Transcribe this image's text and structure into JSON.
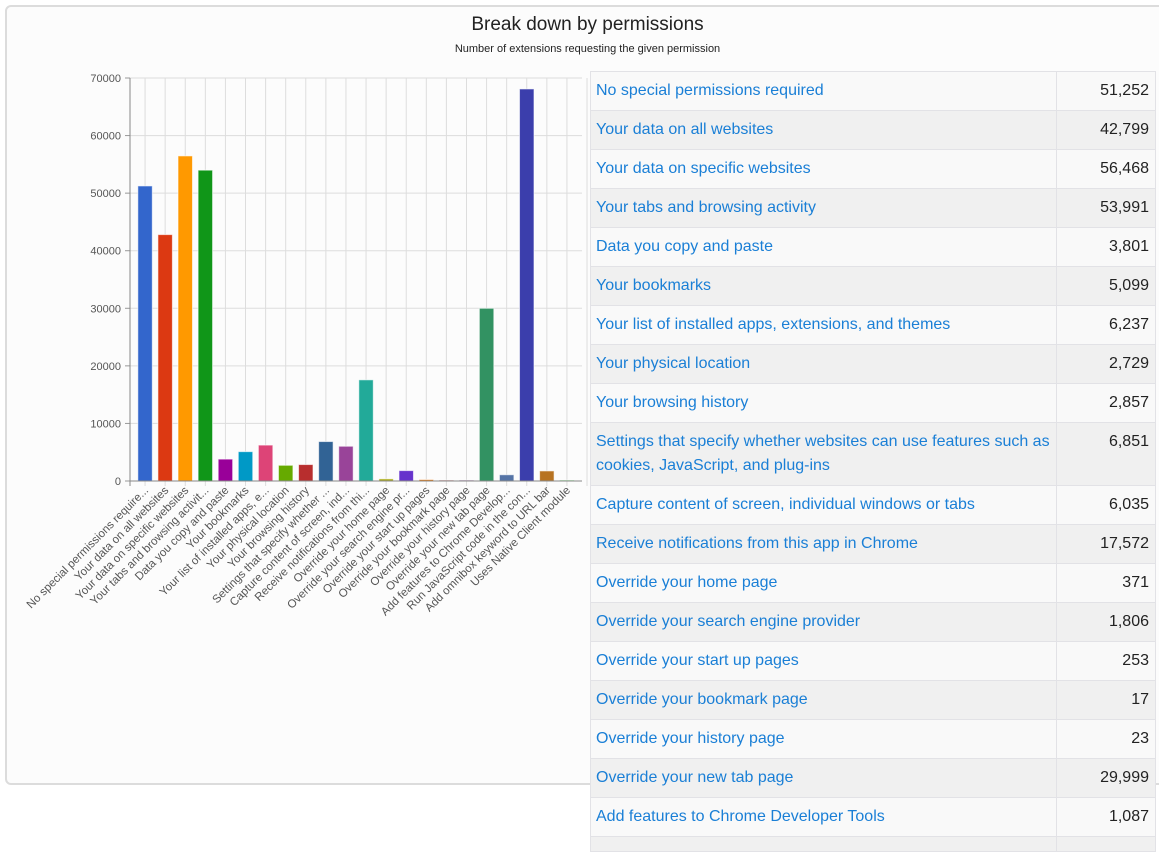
{
  "page": {
    "title": "Break down by permissions",
    "subtitle": "Number of extensions requesting the given permission"
  },
  "chart_data": {
    "type": "bar",
    "title": "Break down by permissions",
    "subtitle": "Number of extensions requesting the given permission",
    "xlabel": "",
    "ylabel": "",
    "ylim": [
      0,
      70000
    ],
    "yticks": [
      0,
      10000,
      20000,
      30000,
      40000,
      50000,
      60000,
      70000
    ],
    "grid": true,
    "legend": "none",
    "categories": [
      "No special permissions require...",
      "Your data on all websites",
      "Your data on specific websites",
      "Your tabs and browsing activit...",
      "Data you copy and paste",
      "Your bookmarks",
      "Your list of installed apps, e...",
      "Your physical location",
      "Your browsing history",
      "Settings that specify whether ...",
      "Capture content of screen, ind...",
      "Receive notifications from thi...",
      "Override your home page",
      "Override your search engine pr...",
      "Override your start up pages",
      "Override your bookmark page",
      "Override your history page",
      "Override your new tab page",
      "Add features to Chrome Develop...",
      "Run JavaScript code in the con...",
      "Add omnibox keyword to URL bar",
      "Uses Native Client module"
    ],
    "values": [
      51252,
      42799,
      56468,
      53991,
      3801,
      5099,
      6237,
      2729,
      2857,
      6851,
      6035,
      17572,
      371,
      1806,
      253,
      17,
      23,
      29999,
      1087,
      68100,
      1750,
      60
    ],
    "colors": [
      "#3366cc",
      "#dc3912",
      "#ff9900",
      "#109618",
      "#990099",
      "#0099c6",
      "#dd4477",
      "#66aa00",
      "#b82e2e",
      "#316395",
      "#994499",
      "#22aa99",
      "#aaaa11",
      "#6633cc",
      "#e67300",
      "#8b0707",
      "#651067",
      "#329262",
      "#5574a6",
      "#3b3eac",
      "#b77322",
      "#16d620"
    ]
  },
  "table": {
    "rows": [
      {
        "name": "No special permissions required",
        "count": "51,252"
      },
      {
        "name": "Your data on all websites",
        "count": "42,799"
      },
      {
        "name": "Your data on specific websites",
        "count": "56,468"
      },
      {
        "name": "Your tabs and browsing activity",
        "count": "53,991"
      },
      {
        "name": "Data you copy and paste",
        "count": "3,801"
      },
      {
        "name": "Your bookmarks",
        "count": "5,099"
      },
      {
        "name": "Your list of installed apps, extensions, and themes",
        "count": "6,237"
      },
      {
        "name": "Your physical location",
        "count": "2,729"
      },
      {
        "name": "Your browsing history",
        "count": "2,857"
      },
      {
        "name": "Settings that specify whether websites can use features such as cookies, JavaScript, and plug-ins",
        "count": "6,851"
      },
      {
        "name": "Capture content of screen, individual windows or tabs",
        "count": "6,035"
      },
      {
        "name": "Receive notifications from this app in Chrome",
        "count": "17,572"
      },
      {
        "name": "Override your home page",
        "count": "371"
      },
      {
        "name": "Override your search engine provider",
        "count": "1,806"
      },
      {
        "name": "Override your start up pages",
        "count": "253"
      },
      {
        "name": "Override your bookmark page",
        "count": "17"
      },
      {
        "name": "Override your history page",
        "count": "23"
      },
      {
        "name": "Override your new tab page",
        "count": "29,999"
      },
      {
        "name": "Add features to Chrome Developer Tools",
        "count": "1,087"
      },
      {
        "name": "",
        "count": ""
      }
    ]
  }
}
